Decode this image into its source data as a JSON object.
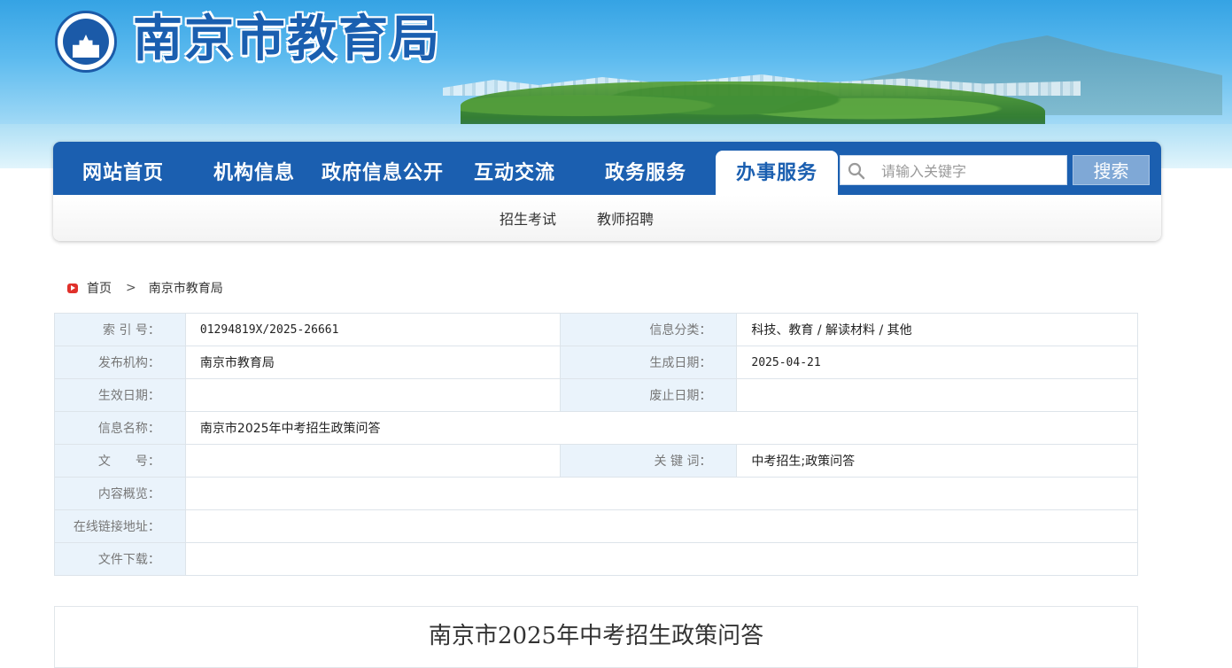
{
  "header": {
    "site_title": "南京市教育局",
    "logo_icon": "nanjing-education-emblem"
  },
  "nav": {
    "items": [
      {
        "label": "网站首页",
        "active": false
      },
      {
        "label": "机构信息",
        "active": false
      },
      {
        "label": "政府信息公开",
        "active": false
      },
      {
        "label": "互动交流",
        "active": false
      },
      {
        "label": "政务服务",
        "active": false
      },
      {
        "label": "办事服务",
        "active": true
      }
    ],
    "search_placeholder": "请输入关键字",
    "search_button": "搜索",
    "sub_items": [
      "招生考试",
      "教师招聘"
    ]
  },
  "breadcrumb": {
    "home": "首页",
    "current": "南京市教育局"
  },
  "meta": {
    "index_no_label": "索 引 号：",
    "index_no": "01294819X/2025-26661",
    "category_label": "信息分类：",
    "category": "科技、教育 / 解读材料 / 其他",
    "publisher_label": "发布机构：",
    "publisher": "南京市教育局",
    "created_label": "生成日期：",
    "created": "2025-04-21",
    "effective_label": "生效日期：",
    "effective": "",
    "expired_label": "废止日期：",
    "expired": "",
    "name_label": "信息名称：",
    "name": "南京市2025年中考招生政策问答",
    "doc_no_label": "文　　号：",
    "doc_no": "",
    "keywords_label": "关 键 词：",
    "keywords": "中考招生;政策问答",
    "summary_label": "内容概览：",
    "summary": "",
    "link_label": "在线链接地址：",
    "link": "",
    "download_label": "文件下载：",
    "download": ""
  },
  "article": {
    "title": "南京市2025年中考招生政策问答"
  },
  "colors": {
    "nav_blue": "#1b5fb0",
    "label_bg": "#eaf3fb",
    "breadcrumb_icon": "#e0312b"
  }
}
